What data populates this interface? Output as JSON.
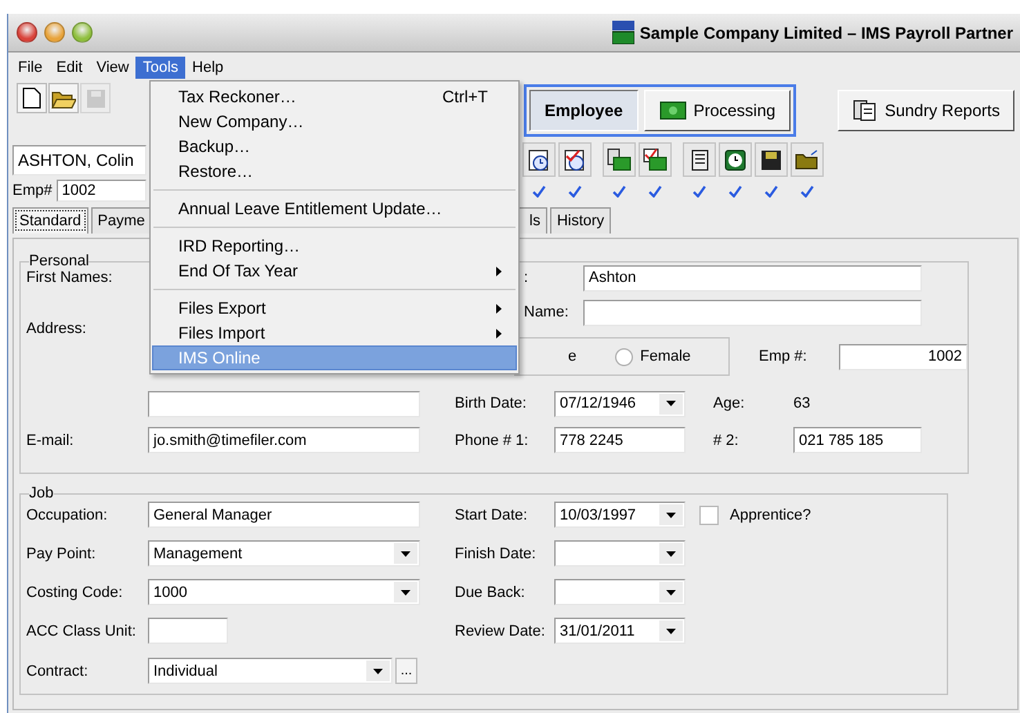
{
  "window": {
    "title": "Sample Company Limited – IMS Payroll Partner"
  },
  "menu_bar": [
    {
      "label": "File",
      "selected": false
    },
    {
      "label": "Edit",
      "selected": false
    },
    {
      "label": "View",
      "selected": false
    },
    {
      "label": "Tools",
      "selected": true
    },
    {
      "label": "Help",
      "selected": false
    }
  ],
  "toolbar": [
    {
      "kind": "new",
      "disabled": false
    },
    {
      "kind": "open",
      "disabled": false
    },
    {
      "kind": "save",
      "disabled": true
    }
  ],
  "mode_buttons": [
    {
      "label": "Employee",
      "selected": true
    },
    {
      "label": "Processing",
      "selected": false
    }
  ],
  "reports_button": "Sundry Reports",
  "employee_picker": "ASHTON, Colin",
  "emp_number": {
    "label": "Emp#",
    "value": "1002"
  },
  "tabs": [
    {
      "label": "Standard",
      "selected": true
    },
    {
      "label": "Payme",
      "selected": false
    },
    {
      "label": "ls",
      "selected": false
    },
    {
      "label": "History",
      "selected": false
    }
  ],
  "personal": {
    "title": "Personal",
    "first_names_label": "First Names:",
    "address_label": "Address:",
    "email_label": "E-mail:",
    "email": "jo.smith@timefiler.com",
    "surname_label": ":",
    "surname": "Ashton",
    "name_label": "Name:",
    "gender_fragment": "e",
    "female": {
      "label": "Female",
      "checked": false
    },
    "emp_no_label": "Emp #:",
    "emp_no": "1002",
    "birth_date_label": "Birth Date:",
    "birth_date": "07/12/1946",
    "age_label": "Age:",
    "age": "63",
    "phone1_label": "Phone # 1:",
    "phone1": "778 2245",
    "phone2_label": "# 2:",
    "phone2": "021 785 185"
  },
  "job": {
    "title": "Job",
    "occupation_label": "Occupation:",
    "occupation": "General Manager",
    "pay_point_label": "Pay Point:",
    "pay_point": "Management",
    "costing_code_label": "Costing Code:",
    "costing_code": "1000",
    "acc_label": "ACC Class Unit:",
    "contract_label": "Contract:",
    "contract": "Individual",
    "contract_more": "...",
    "start_date_label": "Start Date:",
    "start_date": "10/03/1997",
    "apprentice": {
      "label": "Apprentice?",
      "checked": false
    },
    "finish_date_label": "Finish Date:",
    "due_back_label": "Due Back:",
    "review_date_label": "Review Date:",
    "review_date": "31/01/2011"
  },
  "tools_menu": [
    {
      "kind": "item",
      "label": "Tax Reckoner…",
      "shortcut": "Ctrl+T",
      "selected": false
    },
    {
      "kind": "item",
      "label": "New Company…",
      "selected": false
    },
    {
      "kind": "item",
      "label": "Backup…",
      "selected": false
    },
    {
      "kind": "item",
      "label": "Restore…",
      "selected": false
    },
    {
      "kind": "separator"
    },
    {
      "kind": "item",
      "label": "Annual Leave Entitlement Update…",
      "selected": false
    },
    {
      "kind": "separator"
    },
    {
      "kind": "item",
      "label": "IRD Reporting…",
      "selected": false
    },
    {
      "kind": "submenu",
      "label": "End Of Tax Year",
      "selected": false
    },
    {
      "kind": "separator"
    },
    {
      "kind": "submenu",
      "label": "Files Export",
      "selected": false
    },
    {
      "kind": "submenu",
      "label": "Files Import",
      "selected": false
    },
    {
      "kind": "item",
      "label": "IMS Online",
      "selected": true
    }
  ]
}
